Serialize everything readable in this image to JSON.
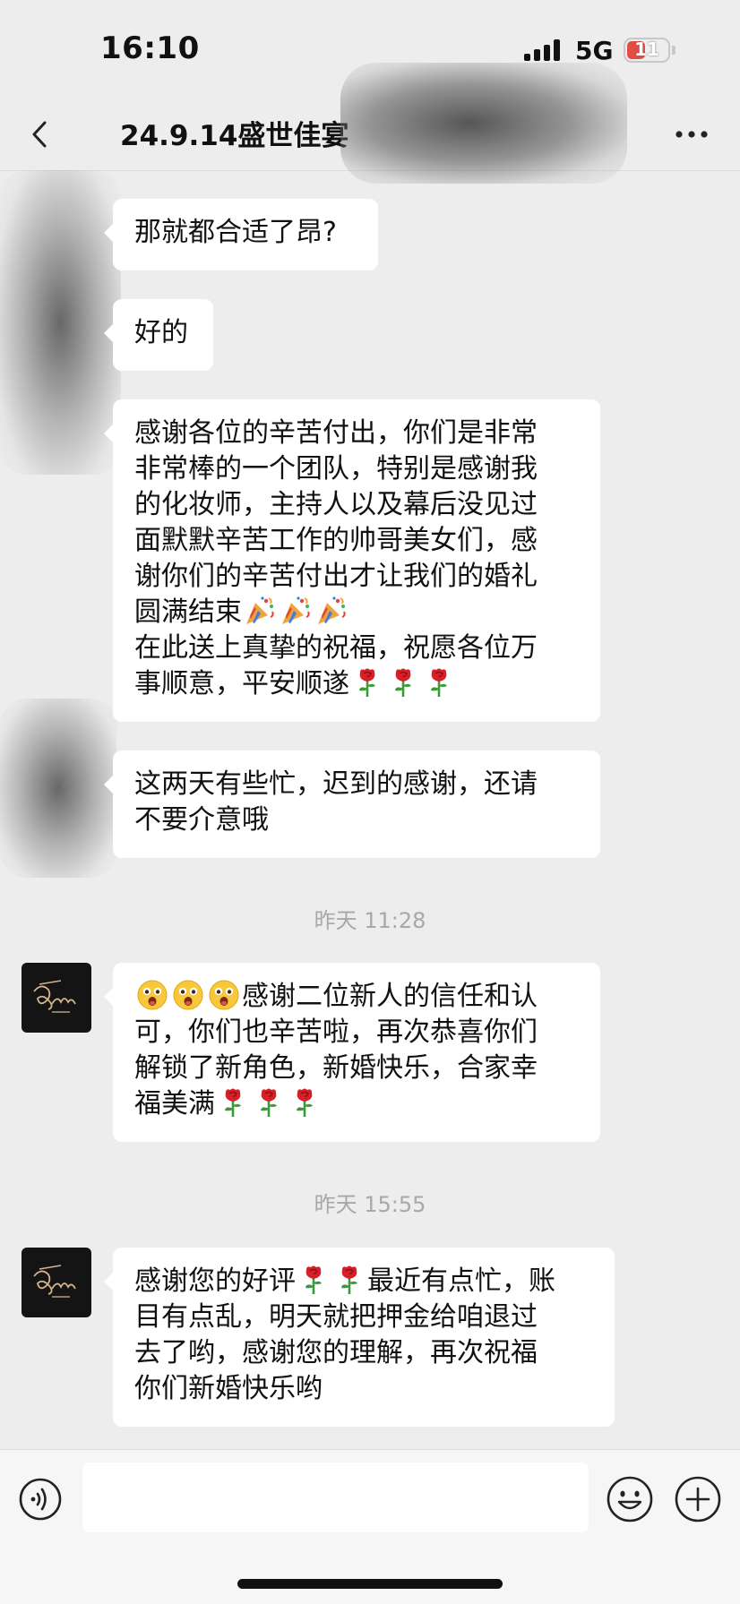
{
  "status_bar": {
    "time": "16:10",
    "network": "5G",
    "battery": "11",
    "battery_level": 0.11
  },
  "nav": {
    "title": "24.9.14盛世佳宴",
    "back_icon": "chevron-left-icon",
    "more_icon": "more-dots-icon"
  },
  "messages": [
    {
      "lines": [
        "那就都合适了昂?"
      ]
    },
    {
      "lines": [
        "好的"
      ]
    },
    {
      "lines": [
        "感谢各位的辛苦付出，你们是非常",
        "非常棒的一个团队，特别是感谢我",
        "的化妆师，主持人以及幕后没见过",
        "面默默辛苦工作的帅哥美女们，感",
        "谢你们的辛苦付出才让我们的婚礼",
        "圆满结束",
        "在此送上真挚的祝福，祝愿各位万",
        "事顺意，平安顺遂"
      ]
    },
    {
      "lines": [
        "这两天有些忙，迟到的感谢，还请",
        "不要介意哦"
      ]
    },
    {
      "lines": [
        "感谢二位新人的信任和认",
        "可，你们也辛苦啦，再次恭喜你们",
        "解锁了新角色，新婚快乐，合家幸",
        "福美满"
      ]
    },
    {
      "lines": [
        "感谢您的好评",
        "最近有点忙，账",
        "目有点乱，明天就把押金给咱退过",
        "去了哟，感谢您的理解，再次祝福",
        "你们新婚快乐哟"
      ]
    }
  ],
  "timestamps": [
    "昨天 11:28",
    "昨天 15:55"
  ],
  "input_bar": {
    "value": "",
    "voice_icon": "voice-icon",
    "emoji_icon": "emoji-icon",
    "plus_icon": "plus-icon"
  },
  "colors": {
    "background": "#ededed",
    "bubble": "#ffffff",
    "timestamp": "#a8a8a8",
    "battery_low": "#e34b45"
  }
}
